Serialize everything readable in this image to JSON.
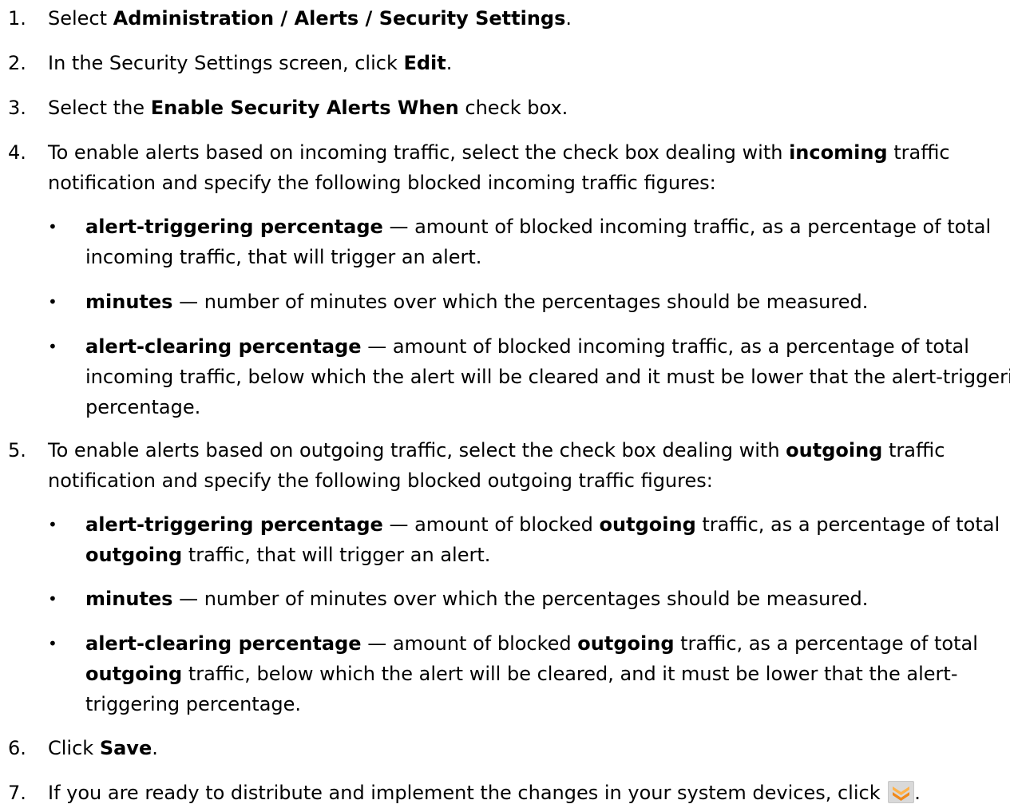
{
  "steps": [
    {
      "num": "1.",
      "pre": "Select ",
      "b1": "Administration",
      "sep1": " / ",
      "b2": "Alerts",
      "sep2": " / ",
      "b3": "Security Settings",
      "post": "."
    },
    {
      "num": "2.",
      "pre": "In the Security Settings screen, click ",
      "b1": "Edit",
      "post": "."
    },
    {
      "num": "3.",
      "pre": "Select the ",
      "b1": "Enable Security Alerts When",
      "post": " check box."
    },
    {
      "num": "4.",
      "l1_pre": "To enable alerts based on incoming traffic, select the check box dealing with ",
      "l1_b": "incoming",
      "l1_post": " traffic",
      "l2": "notification and specify the following blocked incoming traffic figures:"
    },
    {
      "num": "5.",
      "l1_pre": "To enable alerts based on outgoing traffic, select the check box dealing with ",
      "l1_b": "outgoing",
      "l1_post": " traffic",
      "l2": "notification and specify the following blocked outgoing traffic figures:"
    },
    {
      "num": "6.",
      "pre": "Click ",
      "b1": "Save",
      "post": "."
    },
    {
      "num": "7.",
      "pre": "If you are ready to distribute and implement the changes in your system devices, click ",
      "post": "."
    }
  ],
  "bullet_char": "•",
  "incoming_bullets": [
    {
      "term": "alert-triggering percentage",
      "l1": " — amount of blocked incoming traffic, as a percentage of total",
      "l2": "incoming traffic, that will trigger an alert."
    },
    {
      "term": "minutes",
      "l1": " — number of minutes over which the percentages should be measured."
    },
    {
      "term": "alert-clearing percentage",
      "l1": " — amount of blocked incoming traffic, as a percentage of total",
      "l2": "incoming traffic, below which the alert will be cleared and it must be lower that the alert-triggering",
      "l3": "percentage."
    }
  ],
  "outgoing_bullets": [
    {
      "term": "alert-triggering percentage",
      "l1a": " — amount of blocked ",
      "l1b": "outgoing",
      "l1c": " traffic, as a percentage of total",
      "l2a": "outgoing",
      "l2b": " traffic, that will trigger an alert."
    },
    {
      "term": "minutes",
      "l1a": " — number of minutes over which the percentages should be measured."
    },
    {
      "term": "alert-clearing percentage",
      "l1a": " — amount of blocked ",
      "l1b": "outgoing",
      "l1c": " traffic, as a percentage of total",
      "l2a": "outgoing",
      "l2b": " traffic, below which the alert will be cleared, and it must be lower that the alert-",
      "l3": "triggering percentage."
    }
  ],
  "icons": {
    "deploy": "deploy-chevron-icon",
    "colors": {
      "orange": "#f08a1c",
      "orange_light": "#ffb24a",
      "bg": "#c8c8c8"
    }
  }
}
